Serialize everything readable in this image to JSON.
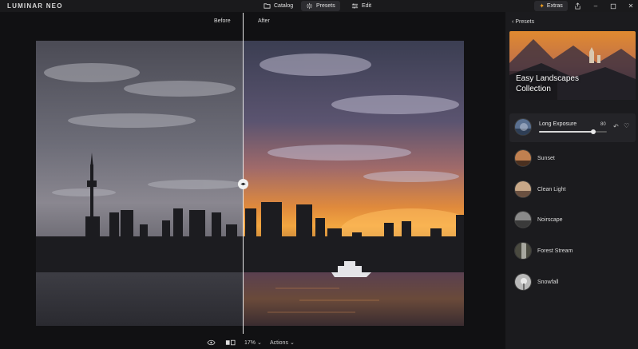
{
  "app": {
    "logo": "LUMINAR NEO"
  },
  "nav": {
    "catalog": "Catalog",
    "presets": "Presets",
    "edit": "Edit",
    "extras": "Extras"
  },
  "compare": {
    "before": "Before",
    "after": "After"
  },
  "bottom": {
    "zoom": "17%",
    "actions": "Actions"
  },
  "panel": {
    "back_label": "Presets",
    "collection_line1": "Easy Landscapes",
    "collection_line2": "Collection",
    "active_preset": {
      "name": "Long Exposure",
      "amount": "80",
      "amount_fraction": 0.8
    },
    "presets": [
      {
        "name": "Sunset"
      },
      {
        "name": "Clean Light"
      },
      {
        "name": "Noirscape"
      },
      {
        "name": "Forest Stream"
      },
      {
        "name": "Snowfall"
      }
    ]
  },
  "colors": {
    "accent": "#f0a020",
    "panel": "#1b1b1e"
  }
}
